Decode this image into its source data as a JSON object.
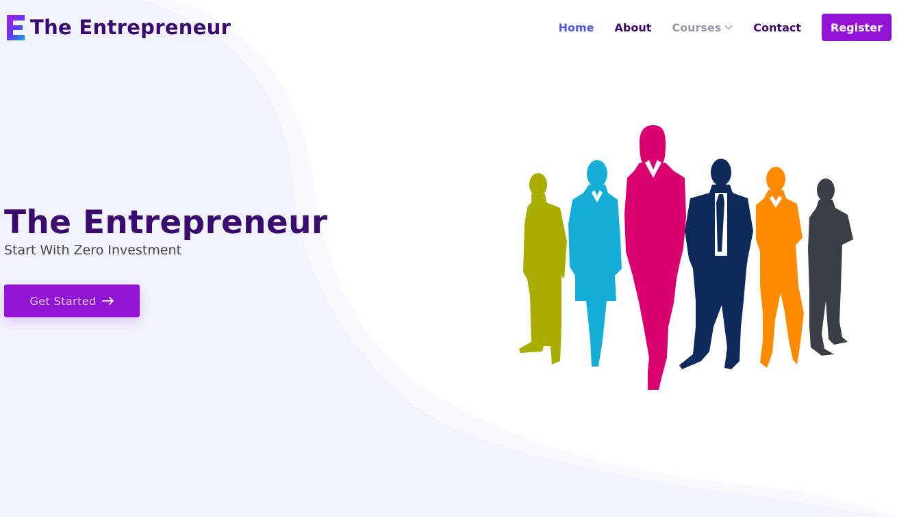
{
  "brand": {
    "name": "The Entrepreneur",
    "logo_icon": "letter-e-logo-icon",
    "colors": {
      "primary": "#9414d6",
      "heading": "#3b0a6e",
      "active_link": "#4f56e6"
    }
  },
  "nav": {
    "home": "Home",
    "about": "About",
    "courses": "Courses",
    "contact": "Contact",
    "register": "Register",
    "courses_icon": "chevron-down-icon"
  },
  "hero": {
    "title": "The Entrepreneur",
    "subtitle": "Start With Zero Investment",
    "cta_label": "Get Started",
    "cta_icon": "arrow-right-icon"
  },
  "illustration": {
    "name": "business-people-silhouettes",
    "figure_colors": [
      "#a9ad00",
      "#16aed6",
      "#d9006f",
      "#0d2a5a",
      "#ff8a00",
      "#3a3f45"
    ]
  }
}
